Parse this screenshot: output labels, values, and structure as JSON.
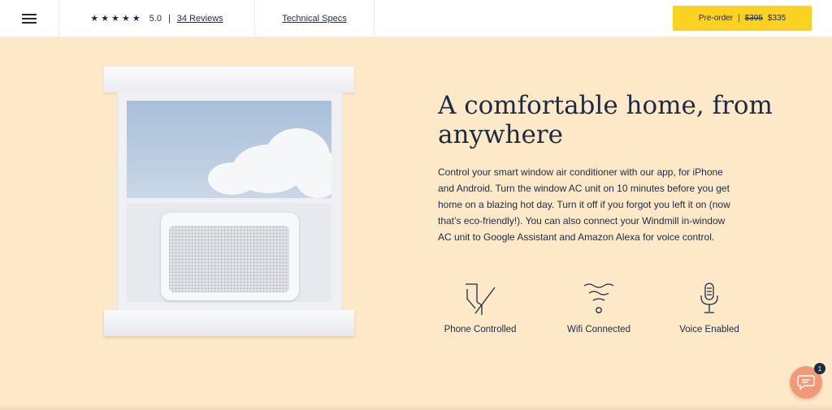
{
  "header": {
    "rating": {
      "stars": "★★★★★",
      "score": "5.0",
      "separator": "|",
      "reviews_label": "34 Reviews"
    },
    "specs_label": "Technical Specs",
    "preorder": {
      "label": "Pre-order",
      "separator": "|",
      "old_price": "$395",
      "new_price": "$335"
    }
  },
  "hero": {
    "title": "A comfortable home, from anywhere",
    "body": "Control your smart window air conditioner with our app, for iPhone and Android. Turn the window AC unit on 10 minutes before you get home on a blazing hot day. Turn it off if you forgot you left it on (now that’s eco-friendly!). You can also connect your Windmill in-window AC unit to Google Assistant and Amazon Alexa for voice control.",
    "features": [
      {
        "icon": "phone-icon",
        "label": "Phone Controlled"
      },
      {
        "icon": "wifi-icon",
        "label": "Wifi Connected"
      },
      {
        "icon": "microphone-icon",
        "label": "Voice Enabled"
      }
    ]
  },
  "chat": {
    "badge_count": "1"
  },
  "colors": {
    "accent": "#fbd122",
    "background": "#fde9c8",
    "text": "#1c2b44",
    "chat": "#f29a78"
  }
}
